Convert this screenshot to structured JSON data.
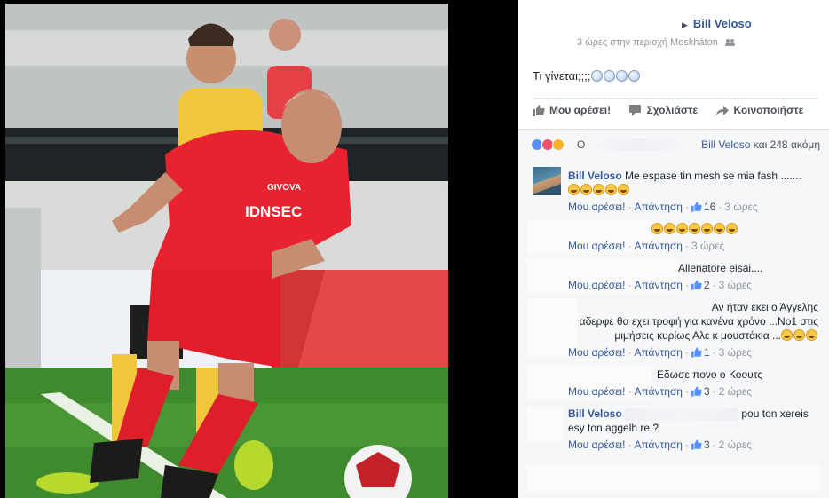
{
  "post": {
    "author": "Bill Veloso",
    "meta": "3 ώρες στην περιοχή Moskháton",
    "text": "Τι γίνεται;;;;",
    "text_emoji_count": 4,
    "actions": {
      "like": "Μου αρέσει!",
      "comment": "Σχολιάστε",
      "share": "Κοινοποιήστε"
    },
    "reactions": {
      "prefix": "Ο",
      "summary_name": "Bill Veloso",
      "summary_rest": "και 248 ακόμη"
    }
  },
  "comments": [
    {
      "author": "Bill Veloso",
      "text": "Me espase tin mesh se mia fash .......",
      "laugh_count": 5,
      "like_label": "Μου αρέσει!",
      "reply_label": "Απάντηση",
      "likes": "16",
      "time": "3 ώρες"
    },
    {
      "author": "",
      "text": "",
      "laugh_count": 7,
      "like_label": "Μου αρέσει!",
      "reply_label": "Απάντηση",
      "likes": "",
      "time": "3 ώρες"
    },
    {
      "author": "",
      "text": "Allenatore eisai....",
      "laugh_count": 0,
      "like_label": "Μου αρέσει!",
      "reply_label": "Απάντηση",
      "likes": "2",
      "time": "3 ώρες"
    },
    {
      "author": "",
      "text_line1": "Αν ήταν εκει ο Άγγελης",
      "text_line2": "αδερφε θα εχει τροφή για κανένα χρόνο ...Νο1 στις",
      "text_line3": "μιμήσεις κυρίως Αλε κ μουστάκια ...",
      "laugh_count": 3,
      "like_label": "Μου αρέσει!",
      "reply_label": "Απάντηση",
      "likes": "1",
      "time": "3 ώρες"
    },
    {
      "author": "",
      "text": "Εδωσε πονο ο Κοουτς",
      "laugh_count": 0,
      "like_label": "Μου αρέσει!",
      "reply_label": "Απάντηση",
      "likes": "3",
      "time": "2 ώρες"
    },
    {
      "author": "Bill Veloso",
      "text_line1": "pou ton xereis",
      "text_line2": "esy ton aggelh re ?",
      "laugh_count": 0,
      "like_label": "Μου αρέσει!",
      "reply_label": "Απάντηση",
      "likes": "3",
      "time": "2 ώρες"
    }
  ],
  "photo": {
    "jersey_sponsor": "IDNSEC",
    "jersey_brand": "GIVOVA"
  },
  "colors": {
    "link": "#365899",
    "muted": "#90949c",
    "jersey_red": "#e8232f",
    "pitch_green": "#3f8a2c"
  }
}
